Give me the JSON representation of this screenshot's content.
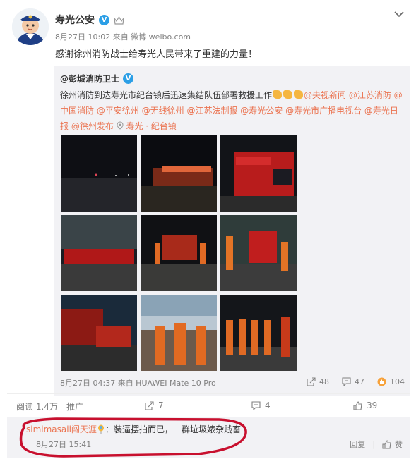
{
  "post": {
    "author": "寿光公安",
    "meta": "8月27日 10:02 来自 微博 weibo.com",
    "text": "感谢徐州消防战士给寿光人民带来了重建的力量！"
  },
  "repost": {
    "author": "@彭城消防卫士",
    "text_start": "徐州消防到达寿光市纪台镇后迅速集结队伍部署救援工作",
    "mentions_line1": "@央视新闻 @江苏消防 @",
    "line2": "中国消防 @平安徐州 @无线徐州 @江苏法制报 @寿光公安 @寿光市广播电视台 @寿光日",
    "line3_mentions": "报 @徐州发布",
    "location": "寿光 · 纪台镇",
    "footer_meta": "8月27日 04:37 来自 HUAWEI Mate 10 Pro",
    "share_count": "48",
    "comment_count": "47",
    "like_count": "104"
  },
  "bottom_bar": {
    "reads": "阅读 1.4万",
    "promote": "推广",
    "share_count": "7",
    "comment_count": "4",
    "like_count": "39"
  },
  "comment": {
    "user": "simimasaii闯天涯",
    "text": "：装逼摆拍而已，一群垃圾婊杂贱畜",
    "time": "8月27日 15:41",
    "reply_label": "回复",
    "like_label": "赞"
  },
  "colors": {
    "mention": "#eb7350",
    "annotation": "#c8102e",
    "vbadge": "#2c9fe6"
  }
}
